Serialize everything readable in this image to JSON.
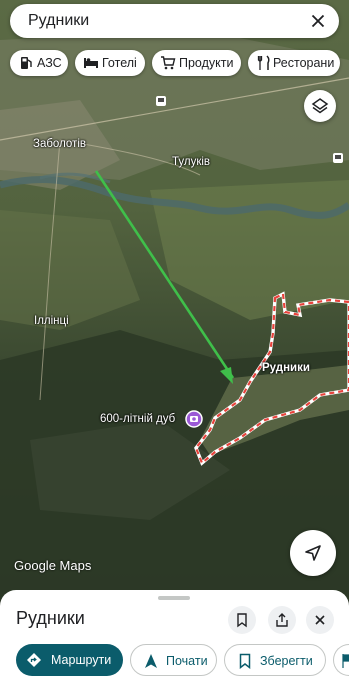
{
  "search": {
    "query": "Рудники"
  },
  "chips": [
    {
      "label": "АЗС",
      "icon": "gas-station-icon"
    },
    {
      "label": "Готелі",
      "icon": "bed-icon"
    },
    {
      "label": "Продукти",
      "icon": "cart-icon"
    },
    {
      "label": "Ресторани",
      "icon": "fork-knife-icon"
    }
  ],
  "map": {
    "places": {
      "zabolotiv": "Заболотів",
      "tulukiv": "Тулуків",
      "illintsi": "Іллінці",
      "rudnyky": "Рудники",
      "oak": "600-літній дуб"
    },
    "brand": "Google Maps",
    "colors": {
      "route_arrow": "#3fbf4a",
      "boundary": "#e8433c",
      "poi": "#9b59d6"
    }
  },
  "sheet": {
    "title": "Рудники",
    "buttons": {
      "directions": "Маршрути",
      "start": "Почати",
      "save": "Зберегти"
    },
    "accent": "#0b5c6b"
  }
}
